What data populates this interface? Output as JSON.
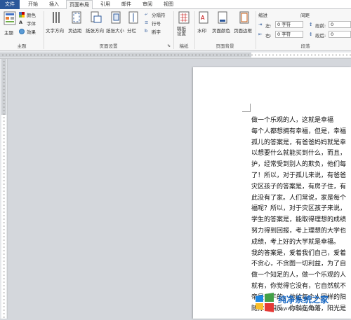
{
  "tabs": [
    "文件",
    "开始",
    "插入",
    "页面布局",
    "引用",
    "邮件",
    "审阅",
    "视图"
  ],
  "ribbon": {
    "theme": {
      "main": "主题",
      "colors": "颜色",
      "fonts": "字体",
      "effects": "效果",
      "group": "主题"
    },
    "page_setup": {
      "buttons": [
        "文字方向",
        "页边距",
        "纸张方向",
        "纸张大小",
        "分栏"
      ],
      "small": [
        "分隔符",
        "行号",
        "断字"
      ],
      "group": "页面设置"
    },
    "manuscript": {
      "button": "稿纸\n设置",
      "group": "稿纸"
    },
    "page_background": {
      "buttons": [
        "水印",
        "页面颜色",
        "页面边框"
      ],
      "group": "页面背景"
    },
    "paragraph": {
      "indent_title": "缩进",
      "spacing_title": "间距",
      "left_label": "左:",
      "right_label": "右:",
      "left_value": "0 字符",
      "right_value": "0 字符",
      "before_label": "段前:",
      "after_label": "段后:",
      "before_value": "0",
      "after_value": "0",
      "group": "段落"
    }
  },
  "document": {
    "lines": [
      "做一个乐观的人，这就是幸福",
      "每个人都想拥有幸福，但是，幸福",
      "孤儿的答案是，有爸爸妈妈就是幸",
      "以想要什么就能买到什么，而且，",
      "护，经常受到别人的欺负，他们每",
      "了！所以，对于孤儿来说，有爸爸",
      "灾区孩子的答案是，有房子住，有",
      "此没有了家。人们常说，家是每个",
      "福呢？所以，对于灾区孩子来说，",
      "学生的答案是，能取得理想的成绩",
      "努力得到回报，考上理想的大学也",
      "成绩，考上好的大学就是幸福。",
      "我的答案是，爱着我们自己，爱着",
      "不贪心，不贪图一切利益，为了自",
      "做一个知足的人，做一个乐观的人",
      "就有，你觉得它没有，它自然就不",
      "帝是公平的，他给每个人同样的阳",
      "随你，相反，你就在角落，阳光是"
    ]
  },
  "watermark": {
    "text": "纯净系统之家",
    "url": "www.ycwjzy.com"
  }
}
